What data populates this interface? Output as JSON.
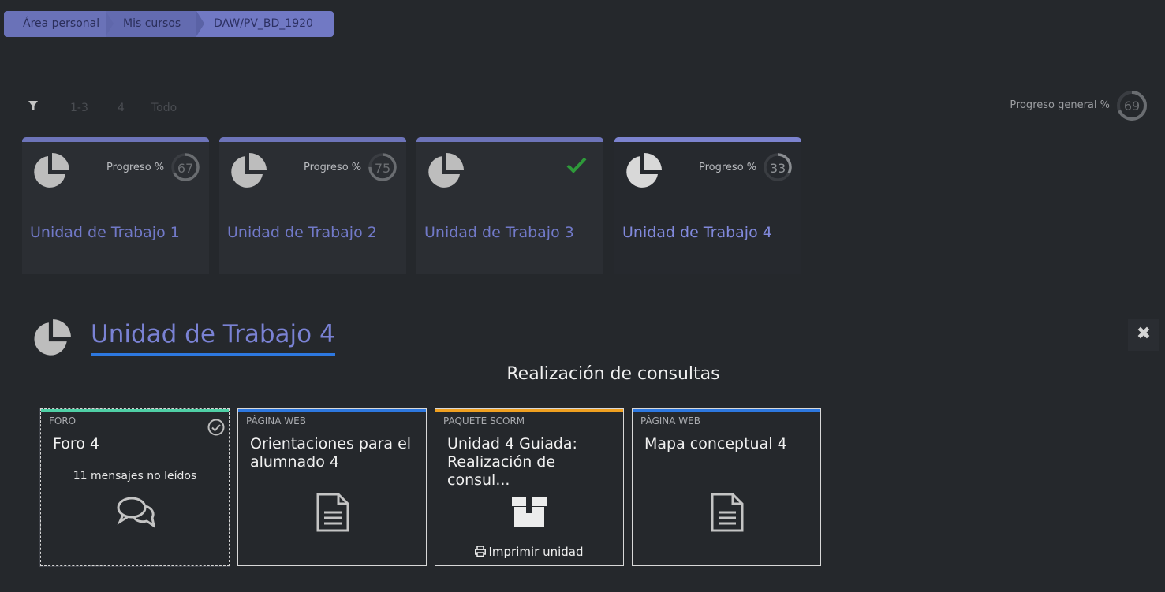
{
  "breadcrumb": [
    "Área personal",
    "Mis cursos",
    "DAW/PV_BD_1920"
  ],
  "filters": {
    "options": [
      "1-3",
      "4",
      "Todo"
    ]
  },
  "overall": {
    "label": "Progreso general %",
    "value": "69"
  },
  "units": [
    {
      "title": "Unidad de Trabajo 1",
      "progress_label": "Progreso %",
      "progress": "67",
      "progress_fraction": 0.67
    },
    {
      "title": "Unidad de Trabajo 2",
      "progress_label": "Progreso %",
      "progress": "75",
      "progress_fraction": 0.75
    },
    {
      "title": "Unidad de Trabajo 3",
      "completed": true
    },
    {
      "title": "Unidad de Trabajo 4",
      "progress_label": "Progreso %",
      "progress": "33",
      "progress_fraction": 0.33
    }
  ],
  "section": {
    "title": "Unidad de Trabajo 4",
    "subtitle": "Realización de consultas"
  },
  "activities": [
    {
      "type": "FORO",
      "name": "Foro 4",
      "unread": "11 mensajes no leídos",
      "color": "#4fd0a6",
      "icon": "chat-icon"
    },
    {
      "type": "PÁGINA WEB",
      "name": "Orientaciones para el alumnado 4",
      "color": "#2d78e0",
      "icon": "document-icon"
    },
    {
      "type": "PAQUETE SCORM",
      "name": "Unidad 4 Guiada: Realización de consul...",
      "color": "#f0a020",
      "icon": "package-icon",
      "print": "Imprimir unidad"
    },
    {
      "type": "PÁGINA WEB",
      "name": "Mapa conceptual 4",
      "color": "#2d78e0",
      "icon": "document-icon"
    }
  ],
  "colors": {
    "accent": "#7179c8",
    "underline": "#2d78e0",
    "check_green": "#2e9a3a"
  }
}
